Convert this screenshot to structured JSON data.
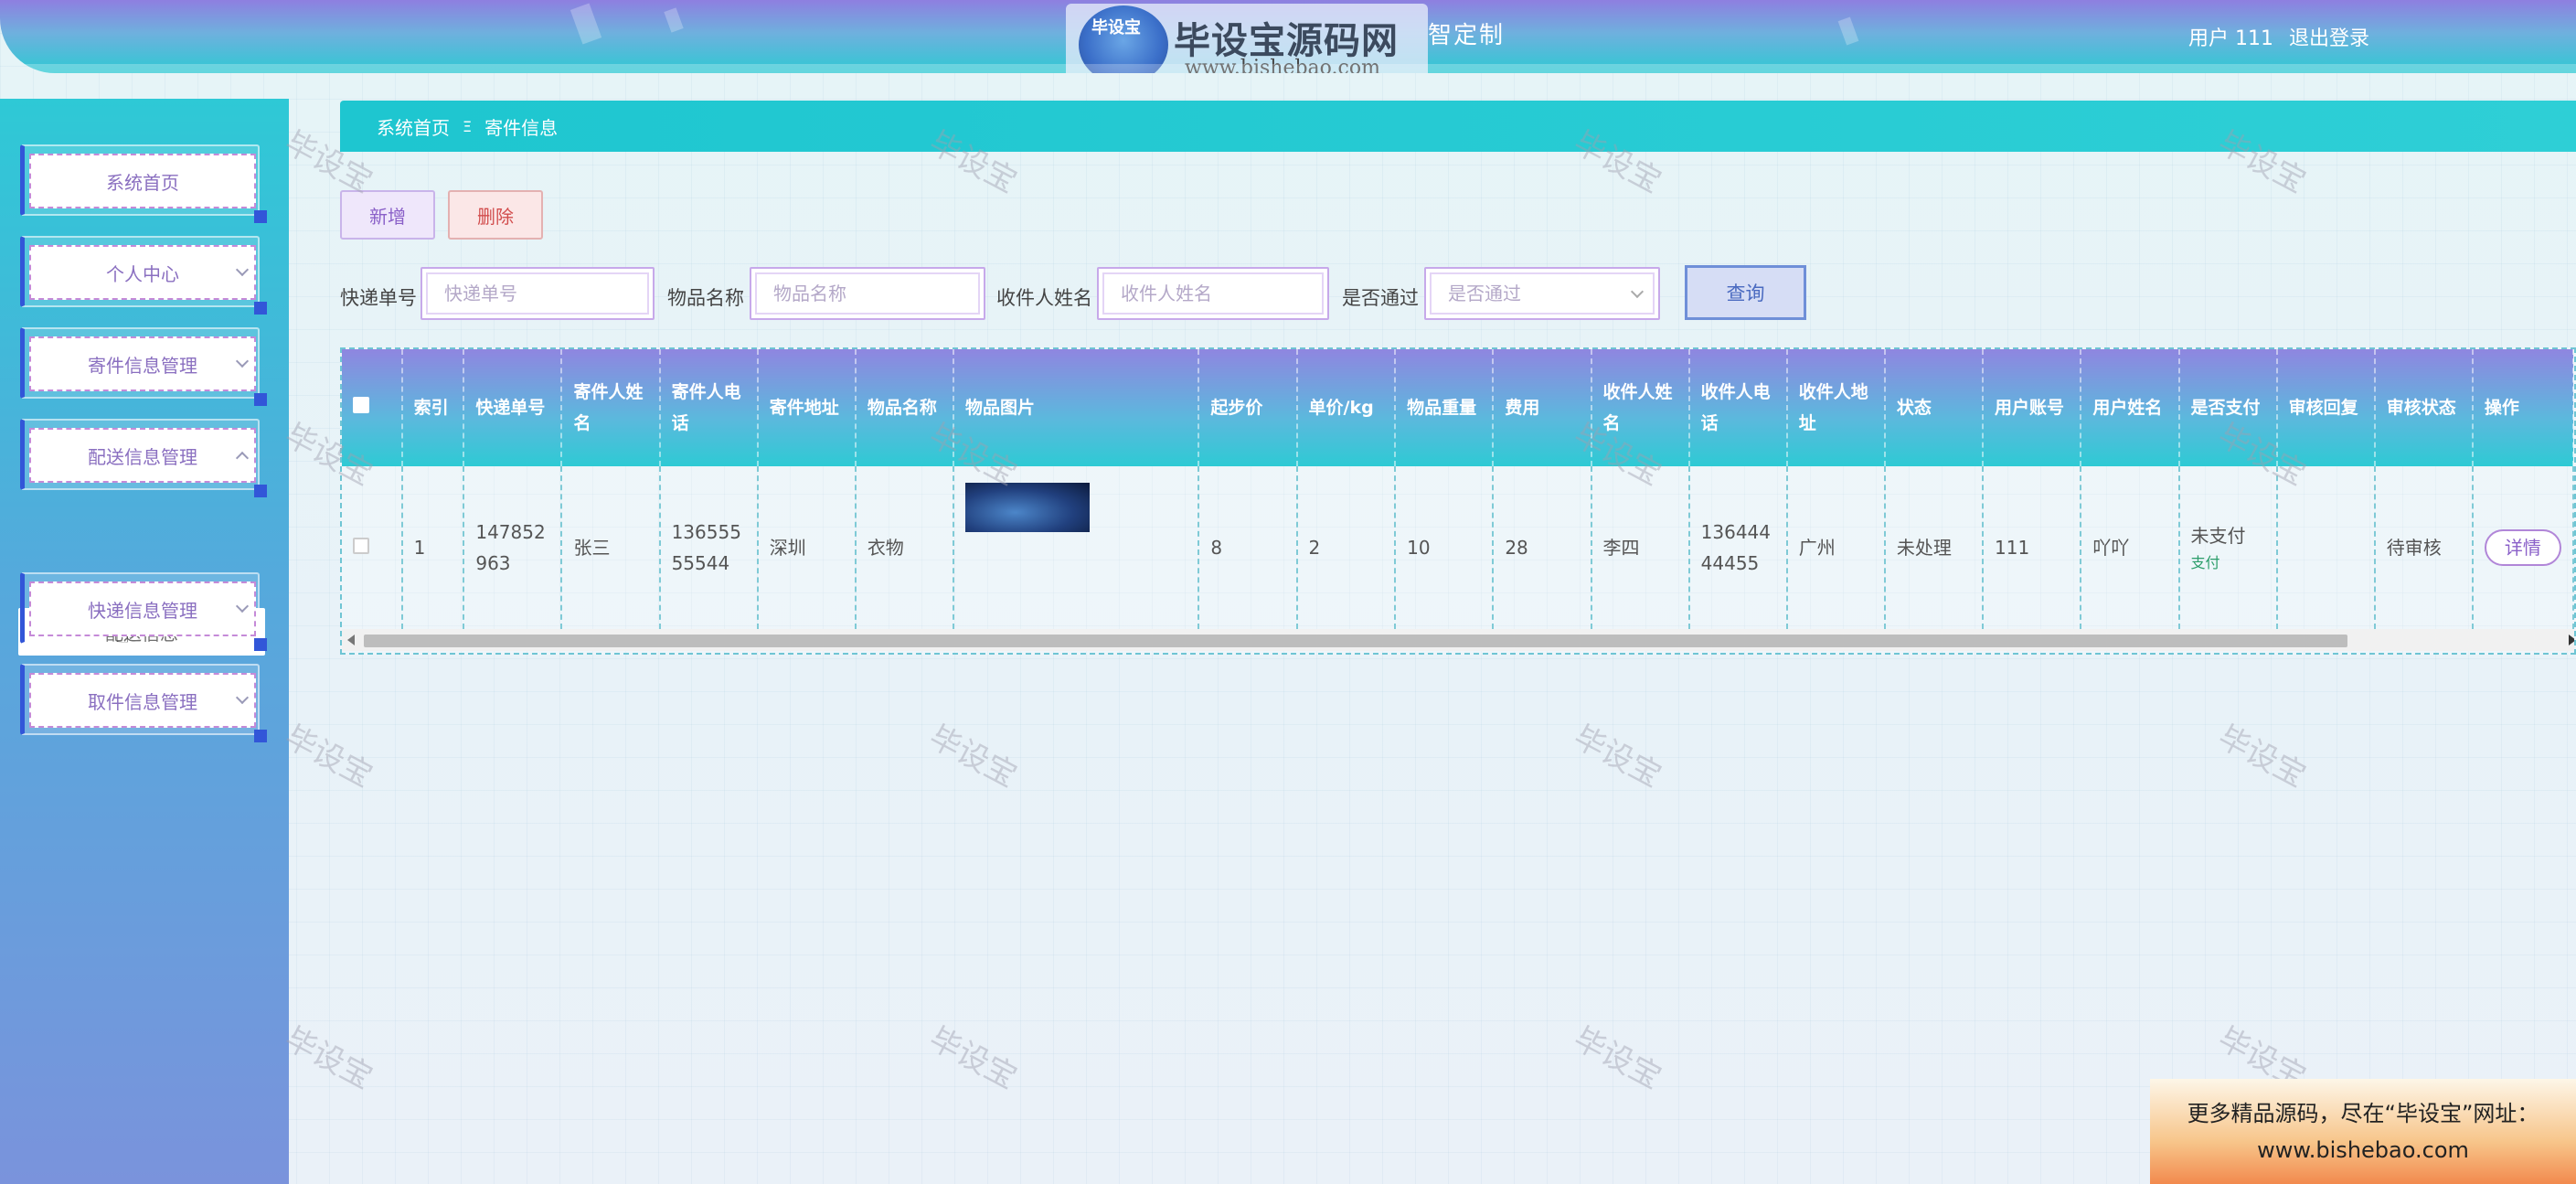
{
  "header": {
    "title": "智定制",
    "logo_main": "毕设宝源码网",
    "logo_seal": "毕设宝",
    "logo_url": "www.bishebao.com",
    "user_label": "用户 111",
    "logout": "退出登录"
  },
  "sidebar": {
    "items": [
      {
        "label": "系统首页"
      },
      {
        "label": "个人中心"
      },
      {
        "label": "寄件信息管理"
      },
      {
        "label": "配送信息管理"
      },
      {
        "label": "快递信息管理"
      },
      {
        "label": "取件信息管理"
      }
    ],
    "submenu_label": "配送信息"
  },
  "breadcrumb": {
    "home": "系统首页",
    "separator": "Ξ",
    "current": "寄件信息"
  },
  "toolbar": {
    "add": "新增",
    "delete": "删除"
  },
  "search": {
    "fields": [
      {
        "label": "快递单号",
        "placeholder": "快递单号"
      },
      {
        "label": "物品名称",
        "placeholder": "物品名称"
      },
      {
        "label": "收件人姓名",
        "placeholder": "收件人姓名"
      },
      {
        "label": "是否通过",
        "placeholder": "是否通过"
      }
    ],
    "query_button": "查询"
  },
  "table": {
    "headers": [
      "索引",
      "快递单号",
      "寄件人姓名",
      "寄件人电话",
      "寄件地址",
      "物品名称",
      "物品图片",
      "起步价",
      "单价/kg",
      "物品重量",
      "费用",
      "收件人姓名",
      "收件人电话",
      "收件人地址",
      "状态",
      "用户账号",
      "用户姓名",
      "是否支付",
      "审核回复",
      "审核状态",
      "操作"
    ],
    "rows": [
      {
        "index": "1",
        "tracking_no": "147852963",
        "sender_name": "张三",
        "sender_phone": "13655555544",
        "sender_address": "深圳",
        "item_name": "衣物",
        "base_price": "8",
        "unit_price": "2",
        "weight": "10",
        "fee": "28",
        "receiver_name": "李四",
        "receiver_phone": "13644444455",
        "receiver_address": "广州",
        "status": "未处理",
        "user_account": "111",
        "user_name": "吖吖",
        "pay_status": "未支付",
        "pay_action": "支付",
        "review_reply": "",
        "review_status": "待审核",
        "detail": "详情"
      }
    ]
  },
  "watermark": "毕设宝",
  "promo": {
    "line1": "更多精品源码，尽在“毕设宝”网址：",
    "line2": "www.bishebao.com"
  }
}
